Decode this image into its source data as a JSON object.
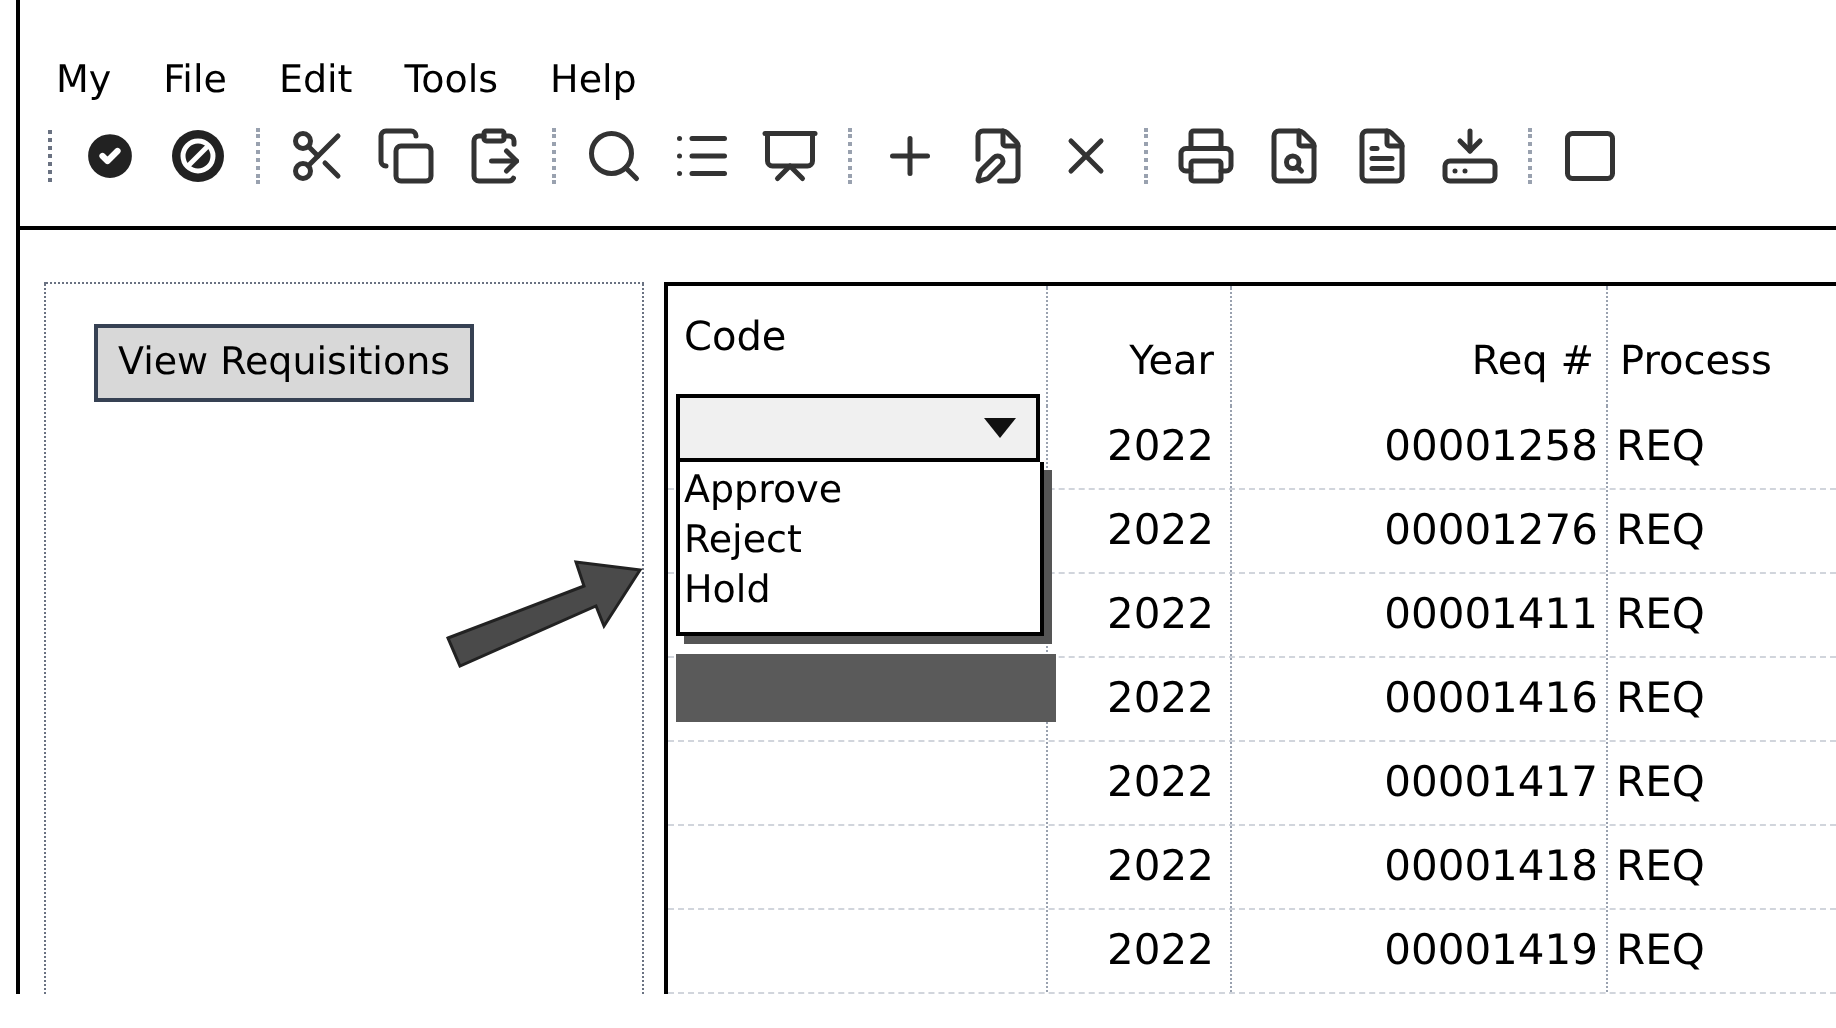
{
  "menu": [
    "My",
    "File",
    "Edit",
    "Tools",
    "Help"
  ],
  "sidebar": {
    "button": "View Requisitions"
  },
  "table": {
    "columns": [
      "Code",
      "Year",
      "Req #",
      "Process"
    ],
    "code_dropdown": {
      "expanded": true,
      "options": [
        {
          "label": "Approve",
          "selected": false
        },
        {
          "label": "Reject",
          "selected": false
        },
        {
          "label": "Hold",
          "selected": false
        }
      ]
    },
    "rows": [
      {
        "year": "2022",
        "req": "00001258",
        "process": "REQ"
      },
      {
        "year": "2022",
        "req": "00001276",
        "process": "REQ"
      },
      {
        "year": "2022",
        "req": "00001411",
        "process": "REQ"
      },
      {
        "year": "2022",
        "req": "00001416",
        "process": "REQ"
      },
      {
        "year": "2022",
        "req": "00001417",
        "process": "REQ"
      },
      {
        "year": "2022",
        "req": "00001418",
        "process": "REQ"
      },
      {
        "year": "2022",
        "req": "00001419",
        "process": "REQ"
      }
    ]
  }
}
